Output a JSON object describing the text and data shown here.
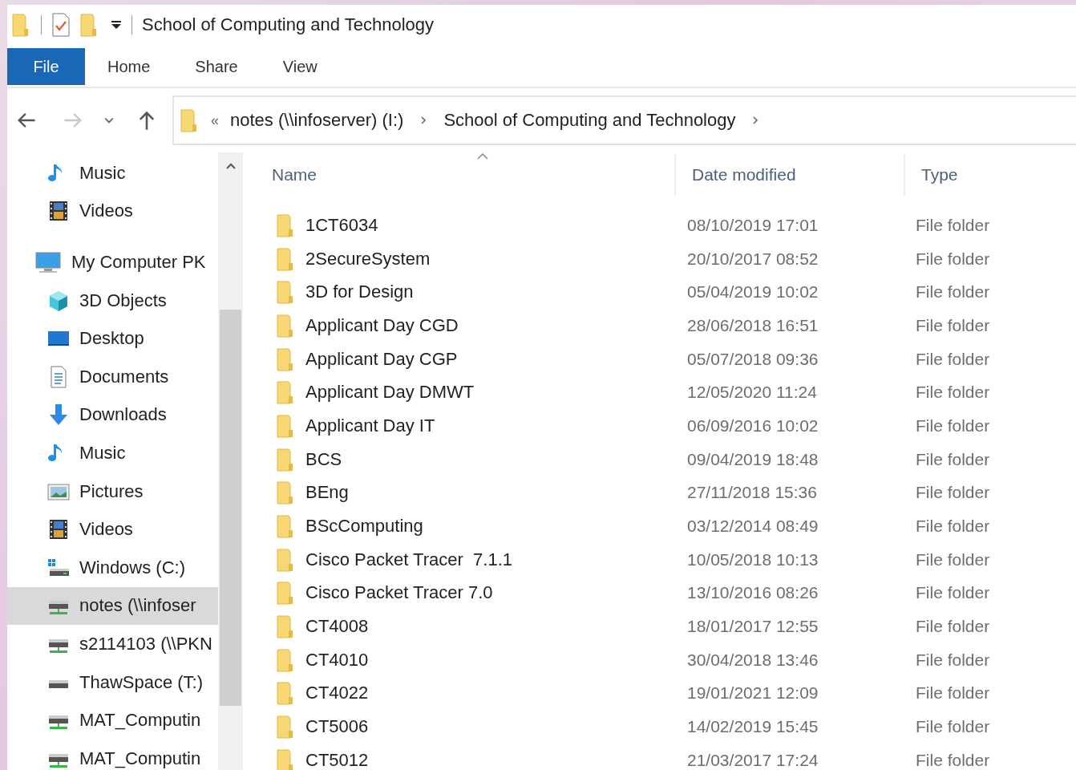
{
  "window": {
    "title": "School of Computing and Technology"
  },
  "ribbon_tabs": [
    {
      "label": "File",
      "selected": true
    },
    {
      "label": "Home",
      "selected": false
    },
    {
      "label": "Share",
      "selected": false
    },
    {
      "label": "View",
      "selected": false
    }
  ],
  "address": {
    "overflow": "«",
    "segments": [
      "notes (\\\\infoserver) (I:)",
      "School of Computing and Technology"
    ]
  },
  "sidebar": {
    "items": [
      {
        "label": "Music",
        "kind": "music",
        "selected": false
      },
      {
        "label": "Videos",
        "kind": "video",
        "selected": false
      },
      {
        "label": "My Computer PK",
        "kind": "computer",
        "selected": false,
        "children": [
          {
            "label": "3D Objects",
            "kind": "cube",
            "selected": false
          },
          {
            "label": "Desktop",
            "kind": "desktop",
            "selected": false
          },
          {
            "label": "Documents",
            "kind": "document",
            "selected": false
          },
          {
            "label": "Downloads",
            "kind": "download",
            "selected": false
          },
          {
            "label": "Music",
            "kind": "music",
            "selected": false
          },
          {
            "label": "Pictures",
            "kind": "pictures",
            "selected": false
          },
          {
            "label": "Videos",
            "kind": "video",
            "selected": false
          },
          {
            "label": "Windows (C:)",
            "kind": "windrive",
            "selected": false
          },
          {
            "label": "notes (\\\\infoser",
            "kind": "netdrive",
            "selected": true
          },
          {
            "label": "s2114103 (\\\\PKN",
            "kind": "netdrive",
            "selected": false
          },
          {
            "label": "ThawSpace (T:)",
            "kind": "drive",
            "selected": false
          },
          {
            "label": "MAT_Computin",
            "kind": "netdrive",
            "selected": false
          },
          {
            "label": "MAT_Computin",
            "kind": "netdrive",
            "selected": false
          }
        ]
      }
    ]
  },
  "table": {
    "columns": [
      "Name",
      "Date modified",
      "Type"
    ],
    "rows": [
      [
        "1CT6034",
        "08/10/2019 17:01",
        "File folder"
      ],
      [
        "2SecureSystem",
        "20/10/2017 08:52",
        "File folder"
      ],
      [
        "3D for Design",
        "05/04/2019 10:02",
        "File folder"
      ],
      [
        "Applicant Day CGD",
        "28/06/2018 16:51",
        "File folder"
      ],
      [
        "Applicant Day CGP",
        "05/07/2018 09:36",
        "File folder"
      ],
      [
        "Applicant Day DMWT",
        "12/05/2020 11:24",
        "File folder"
      ],
      [
        "Applicant Day IT",
        "06/09/2016 10:02",
        "File folder"
      ],
      [
        "BCS",
        "09/04/2019 18:48",
        "File folder"
      ],
      [
        "BEng",
        "27/11/2018 15:36",
        "File folder"
      ],
      [
        "BScComputing",
        "03/12/2014 08:49",
        "File folder"
      ],
      [
        "Cisco Packet Tracer  7.1.1",
        "10/05/2018 10:13",
        "File folder"
      ],
      [
        "Cisco Packet Tracer 7.0",
        "13/10/2016 08:26",
        "File folder"
      ],
      [
        "CT4008",
        "18/01/2017 12:55",
        "File folder"
      ],
      [
        "CT4010",
        "30/04/2018 13:46",
        "File folder"
      ],
      [
        "CT4022",
        "19/01/2021 12:09",
        "File folder"
      ],
      [
        "CT5006",
        "14/02/2019 15:45",
        "File folder"
      ],
      [
        "CT5012",
        "21/03/2017 17:24",
        "File folder"
      ]
    ]
  }
}
